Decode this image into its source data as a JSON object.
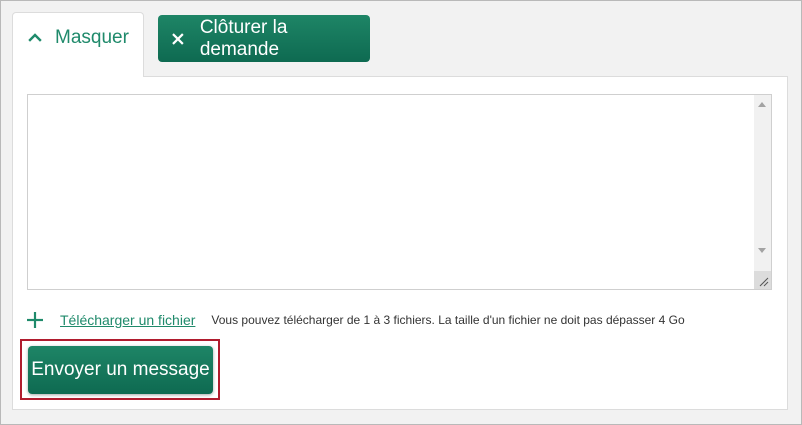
{
  "tabs": {
    "hide_label": "Masquer",
    "close_request_label": "Clôturer la demande"
  },
  "message": {
    "value": "",
    "placeholder": ""
  },
  "upload": {
    "link_label": "Télécharger un fichier",
    "hint": "Vous pouvez télécharger de 1 à 3 fichiers. La taille d'un fichier ne doit pas dépasser 4 Go"
  },
  "send": {
    "label": "Envoyer un message"
  },
  "icons": {
    "hide": "chevron-up-icon",
    "close": "close-icon",
    "upload": "plus-icon"
  },
  "colors": {
    "brand_green": "#1f8a6b",
    "button_green": "#137458",
    "highlight_red": "#b01c2e"
  }
}
